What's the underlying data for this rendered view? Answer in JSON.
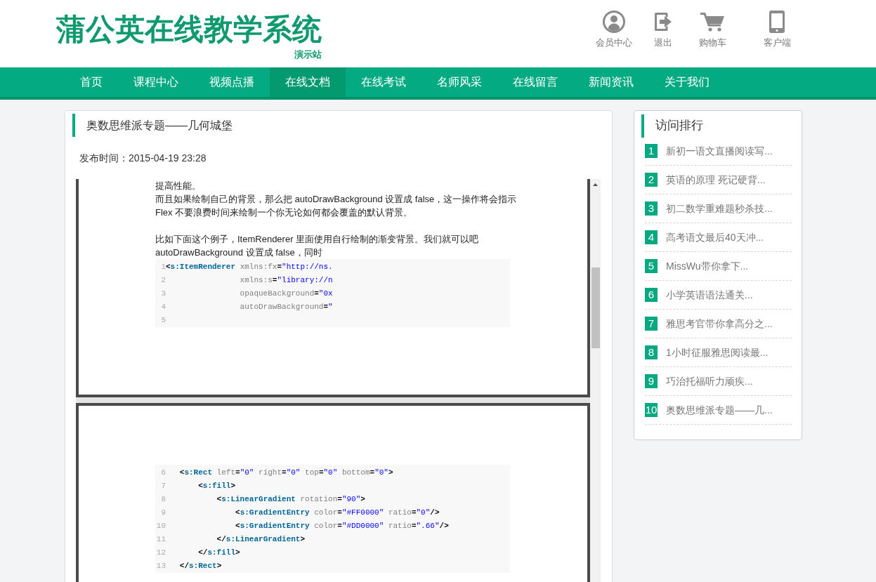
{
  "header": {
    "logo": "蒲公英在线教学系统",
    "logo_tag": "演示站",
    "links": [
      {
        "label": "会员中心",
        "kind": "user"
      },
      {
        "label": "退出",
        "kind": "logout"
      },
      {
        "label": "购物车",
        "kind": "cart"
      },
      {
        "label": "客户端",
        "kind": "phone"
      }
    ]
  },
  "nav": [
    {
      "label": "首页",
      "selected": false
    },
    {
      "label": "课程中心",
      "selected": false
    },
    {
      "label": "视频点播",
      "selected": false
    },
    {
      "label": "在线文档",
      "selected": true
    },
    {
      "label": "在线考试",
      "selected": false
    },
    {
      "label": "名师风采",
      "selected": false
    },
    {
      "label": "在线留言",
      "selected": false
    },
    {
      "label": "新闻资讯",
      "selected": false
    },
    {
      "label": "关于我们",
      "selected": false
    }
  ],
  "article": {
    "title": "奥数思维派专题——几何城堡",
    "published": "发布时间：2015-04-19 23:28",
    "pages": [
      {
        "blocks": [
          {
            "kind": "text",
            "lines": [
              "提高性能。",
              "而且如果绘制自己的背景，那么把 autoDrawBackground 设置成 false，这一操作将会指示",
              "Flex 不要浪费时间来绘制一个你无论如何都会覆盖的默认背景。"
            ]
          },
          {
            "kind": "text",
            "lines": [
              "比如下面这个例子，ItemRenderer 里面使用自行绘制的渐变背景。我们就可以吧",
              "autoDrawBackground 设置成 false，同时"
            ]
          },
          {
            "kind": "code",
            "lines": [
              {
                "number": "1",
                "tokens": [
                  {
                    "kind": "punct",
                    "text": "<"
                  },
                  {
                    "kind": "tag",
                    "text": "s:ItemRenderer"
                  },
                  {
                    "kind": "attr",
                    "text": " xmlns:fx"
                  },
                  {
                    "kind": "punct",
                    "text": "="
                  },
                  {
                    "kind": "string",
                    "text": "\"http://ns."
                  }
                ]
              },
              {
                "number": "2",
                "tokens": [
                  {
                    "kind": "attr",
                    "text": "                xmlns:s"
                  },
                  {
                    "kind": "punct",
                    "text": "="
                  },
                  {
                    "kind": "string",
                    "text": "\"library://n"
                  }
                ]
              },
              {
                "number": "3",
                "tokens": [
                  {
                    "kind": "attr",
                    "text": "                opaqueBackground"
                  },
                  {
                    "kind": "punct",
                    "text": "="
                  },
                  {
                    "kind": "string",
                    "text": "\"0x"
                  }
                ]
              },
              {
                "number": "4",
                "tokens": [
                  {
                    "kind": "attr",
                    "text": "                autoDrawBackground"
                  },
                  {
                    "kind": "punct",
                    "text": "="
                  },
                  {
                    "kind": "string",
                    "text": "\""
                  }
                ]
              },
              {
                "number": "5"
              }
            ]
          }
        ]
      },
      {
        "blocks": [
          {
            "kind": "code",
            "lines": [
              {
                "number": "6",
                "tokens": [
                  {
                    "kind": "punct",
                    "text": "   <"
                  },
                  {
                    "kind": "tag",
                    "text": "s:Rect"
                  },
                  {
                    "kind": "attr",
                    "text": " left"
                  },
                  {
                    "kind": "punct",
                    "text": "="
                  },
                  {
                    "kind": "string",
                    "text": "\"0\""
                  },
                  {
                    "kind": "attr",
                    "text": " right"
                  },
                  {
                    "kind": "punct",
                    "text": "="
                  },
                  {
                    "kind": "string",
                    "text": "\"0\""
                  },
                  {
                    "kind": "attr",
                    "text": " top"
                  },
                  {
                    "kind": "punct",
                    "text": "="
                  },
                  {
                    "kind": "string",
                    "text": "\"0\""
                  },
                  {
                    "kind": "attr",
                    "text": " bottom"
                  },
                  {
                    "kind": "punct",
                    "text": "="
                  },
                  {
                    "kind": "string",
                    "text": "\"0\""
                  },
                  {
                    "kind": "punct",
                    "text": ">"
                  }
                ]
              },
              {
                "number": "7",
                "tokens": [
                  {
                    "kind": "punct",
                    "text": "       <"
                  },
                  {
                    "kind": "tag",
                    "text": "s:fill"
                  },
                  {
                    "kind": "punct",
                    "text": ">"
                  }
                ]
              },
              {
                "number": "8",
                "tokens": [
                  {
                    "kind": "punct",
                    "text": "           <"
                  },
                  {
                    "kind": "tag",
                    "text": "s:LinearGradient"
                  },
                  {
                    "kind": "attr",
                    "text": " rotation"
                  },
                  {
                    "kind": "punct",
                    "text": "="
                  },
                  {
                    "kind": "string",
                    "text": "\"90\""
                  },
                  {
                    "kind": "punct",
                    "text": ">"
                  }
                ]
              },
              {
                "number": "9",
                "tokens": [
                  {
                    "kind": "punct",
                    "text": "               <"
                  },
                  {
                    "kind": "tag",
                    "text": "s:GradientEntry"
                  },
                  {
                    "kind": "attr",
                    "text": " color"
                  },
                  {
                    "kind": "punct",
                    "text": "="
                  },
                  {
                    "kind": "string",
                    "text": "\"#FF0000\""
                  },
                  {
                    "kind": "attr",
                    "text": " ratio"
                  },
                  {
                    "kind": "punct",
                    "text": "="
                  },
                  {
                    "kind": "string",
                    "text": "\"0\""
                  },
                  {
                    "kind": "punct",
                    "text": "/>"
                  }
                ]
              },
              {
                "number": "10",
                "tokens": [
                  {
                    "kind": "punct",
                    "text": "               <"
                  },
                  {
                    "kind": "tag",
                    "text": "s:GradientEntry"
                  },
                  {
                    "kind": "attr",
                    "text": " color"
                  },
                  {
                    "kind": "punct",
                    "text": "="
                  },
                  {
                    "kind": "string",
                    "text": "\"#DD0000\""
                  },
                  {
                    "kind": "attr",
                    "text": " ratio"
                  },
                  {
                    "kind": "punct",
                    "text": "="
                  },
                  {
                    "kind": "string",
                    "text": "\".66\""
                  },
                  {
                    "kind": "punct",
                    "text": "/>"
                  }
                ]
              },
              {
                "number": "11",
                "tokens": [
                  {
                    "kind": "punct",
                    "text": "           </"
                  },
                  {
                    "kind": "tag",
                    "text": "s:LinearGradient"
                  },
                  {
                    "kind": "punct",
                    "text": ">"
                  }
                ]
              },
              {
                "number": "12",
                "tokens": [
                  {
                    "kind": "punct",
                    "text": "       </"
                  },
                  {
                    "kind": "tag",
                    "text": "s:fill"
                  },
                  {
                    "kind": "punct",
                    "text": ">"
                  }
                ]
              },
              {
                "number": "13",
                "tokens": [
                  {
                    "kind": "punct",
                    "text": "   </"
                  },
                  {
                    "kind": "tag",
                    "text": "s:Rect"
                  },
                  {
                    "kind": "punct",
                    "text": ">"
                  }
                ]
              }
            ]
          }
        ]
      }
    ]
  },
  "ranking": {
    "title": "访问排行",
    "items": [
      {
        "rank": "1",
        "title": "新初一语文直播阅读写..."
      },
      {
        "rank": "2",
        "title": "英语的原理 死记硬背..."
      },
      {
        "rank": "3",
        "title": "初二数学重难题秒杀技..."
      },
      {
        "rank": "4",
        "title": "高考语文最后40天冲..."
      },
      {
        "rank": "5",
        "title": "MissWu带你拿下..."
      },
      {
        "rank": "6",
        "title": "小学英语语法通关..."
      },
      {
        "rank": "7",
        "title": "雅思考官带你拿高分之..."
      },
      {
        "rank": "8",
        "title": "1小时征服雅思阅读最..."
      },
      {
        "rank": "9",
        "title": "巧治托福听力顽疾..."
      },
      {
        "rank": "10",
        "title": "奥数思维派专题——几..."
      }
    ]
  }
}
